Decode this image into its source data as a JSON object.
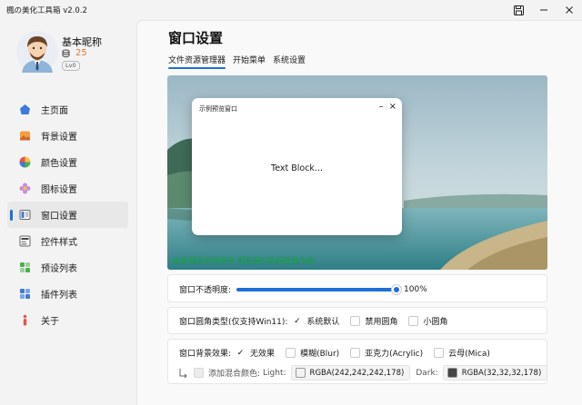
{
  "window": {
    "title": "楓の美化工具箱 v2.0.2"
  },
  "profile": {
    "nickname": "基本昵称",
    "coins": "25",
    "level": "Lv0"
  },
  "nav": {
    "items": [
      {
        "label": "主页面",
        "icon": "home-icon"
      },
      {
        "label": "背景设置",
        "icon": "image-icon"
      },
      {
        "label": "颜色设置",
        "icon": "color-wheel-icon"
      },
      {
        "label": "图标设置",
        "icon": "flower-icon"
      },
      {
        "label": "窗口设置",
        "icon": "window-icon",
        "active": true
      },
      {
        "label": "控件样式",
        "icon": "controls-icon"
      },
      {
        "label": "预设列表",
        "icon": "preset-icon"
      },
      {
        "label": "插件列表",
        "icon": "plugin-icon"
      },
      {
        "label": "关于",
        "icon": "info-icon"
      }
    ]
  },
  "page": {
    "title": "窗口设置",
    "tabs": [
      "文件资源管理器",
      "开始菜单",
      "系统设置"
    ],
    "active_tab": 0
  },
  "preview": {
    "window_title": "示例预览窗口",
    "body_text": "Text Block...",
    "note": "此处预览仅供参考 实际请以系统效果为准"
  },
  "opacity": {
    "label": "窗口不透明度:",
    "value_text": "100%",
    "value": 1.0
  },
  "corner": {
    "label": "窗口圆角类型(仅支持Win11):",
    "options": [
      {
        "label": "系统默认",
        "checked": true
      },
      {
        "label": "禁用圆角",
        "checked": false
      },
      {
        "label": "小圆角",
        "checked": false
      }
    ]
  },
  "effect": {
    "label": "窗口背景效果:",
    "options": [
      {
        "label": "无效果",
        "checked": true
      },
      {
        "label": "模糊(Blur)",
        "checked": false
      },
      {
        "label": "亚克力(Acrylic)",
        "checked": false
      },
      {
        "label": "云母(Mica)",
        "checked": false
      }
    ]
  },
  "blend": {
    "label": "添加混合颜色:",
    "light_label": "Light:",
    "light_value": "RGBA(242,242,242,178)",
    "light_color": "#f2f2f2",
    "dark_label": "Dark:",
    "dark_value": "RGBA(32,32,32,178)",
    "dark_color": "#444444"
  },
  "colors": {
    "accent": "#1e6fd6",
    "note_green": "#1bb349",
    "coin": "#e07a2f"
  }
}
